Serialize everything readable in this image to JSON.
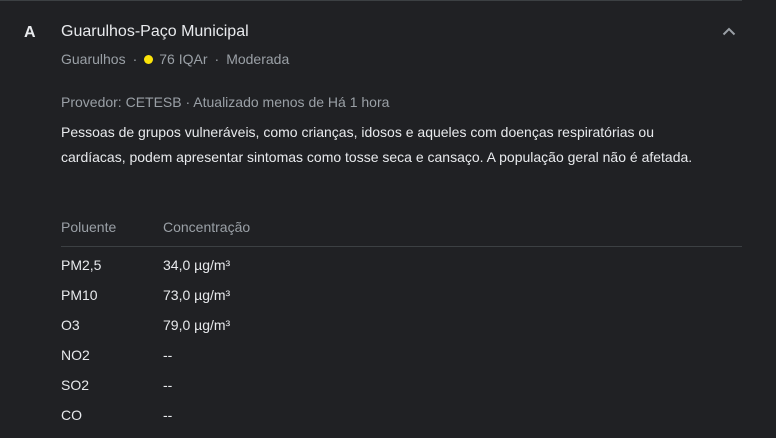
{
  "location": {
    "marker": "A",
    "name": "Guarulhos-Paço Municipal",
    "city": "Guarulhos",
    "aqi_text": "76 IQAr",
    "aqi_dot_color": "#fbe30a",
    "level": "Moderada"
  },
  "provider_text": "Provedor: CETESB · Atualizado menos de Há 1 hora",
  "description": "Pessoas de grupos vulneráveis, como crianças, idosos e aqueles com doenças respiratórias ou cardíacas, podem apresentar sintomas como tosse seca e cansaço. A população geral não é afetada.",
  "table": {
    "headers": [
      "Poluente",
      "Concentração"
    ],
    "rows": [
      [
        "PM2,5",
        "34,0 µg/m³"
      ],
      [
        "PM10",
        "73,0 µg/m³"
      ],
      [
        "O3",
        "79,0 µg/m³"
      ],
      [
        "NO2",
        "--"
      ],
      [
        "SO2",
        "--"
      ],
      [
        "CO",
        "--"
      ]
    ]
  },
  "icons": {
    "collapse": "chevron-up-icon"
  }
}
